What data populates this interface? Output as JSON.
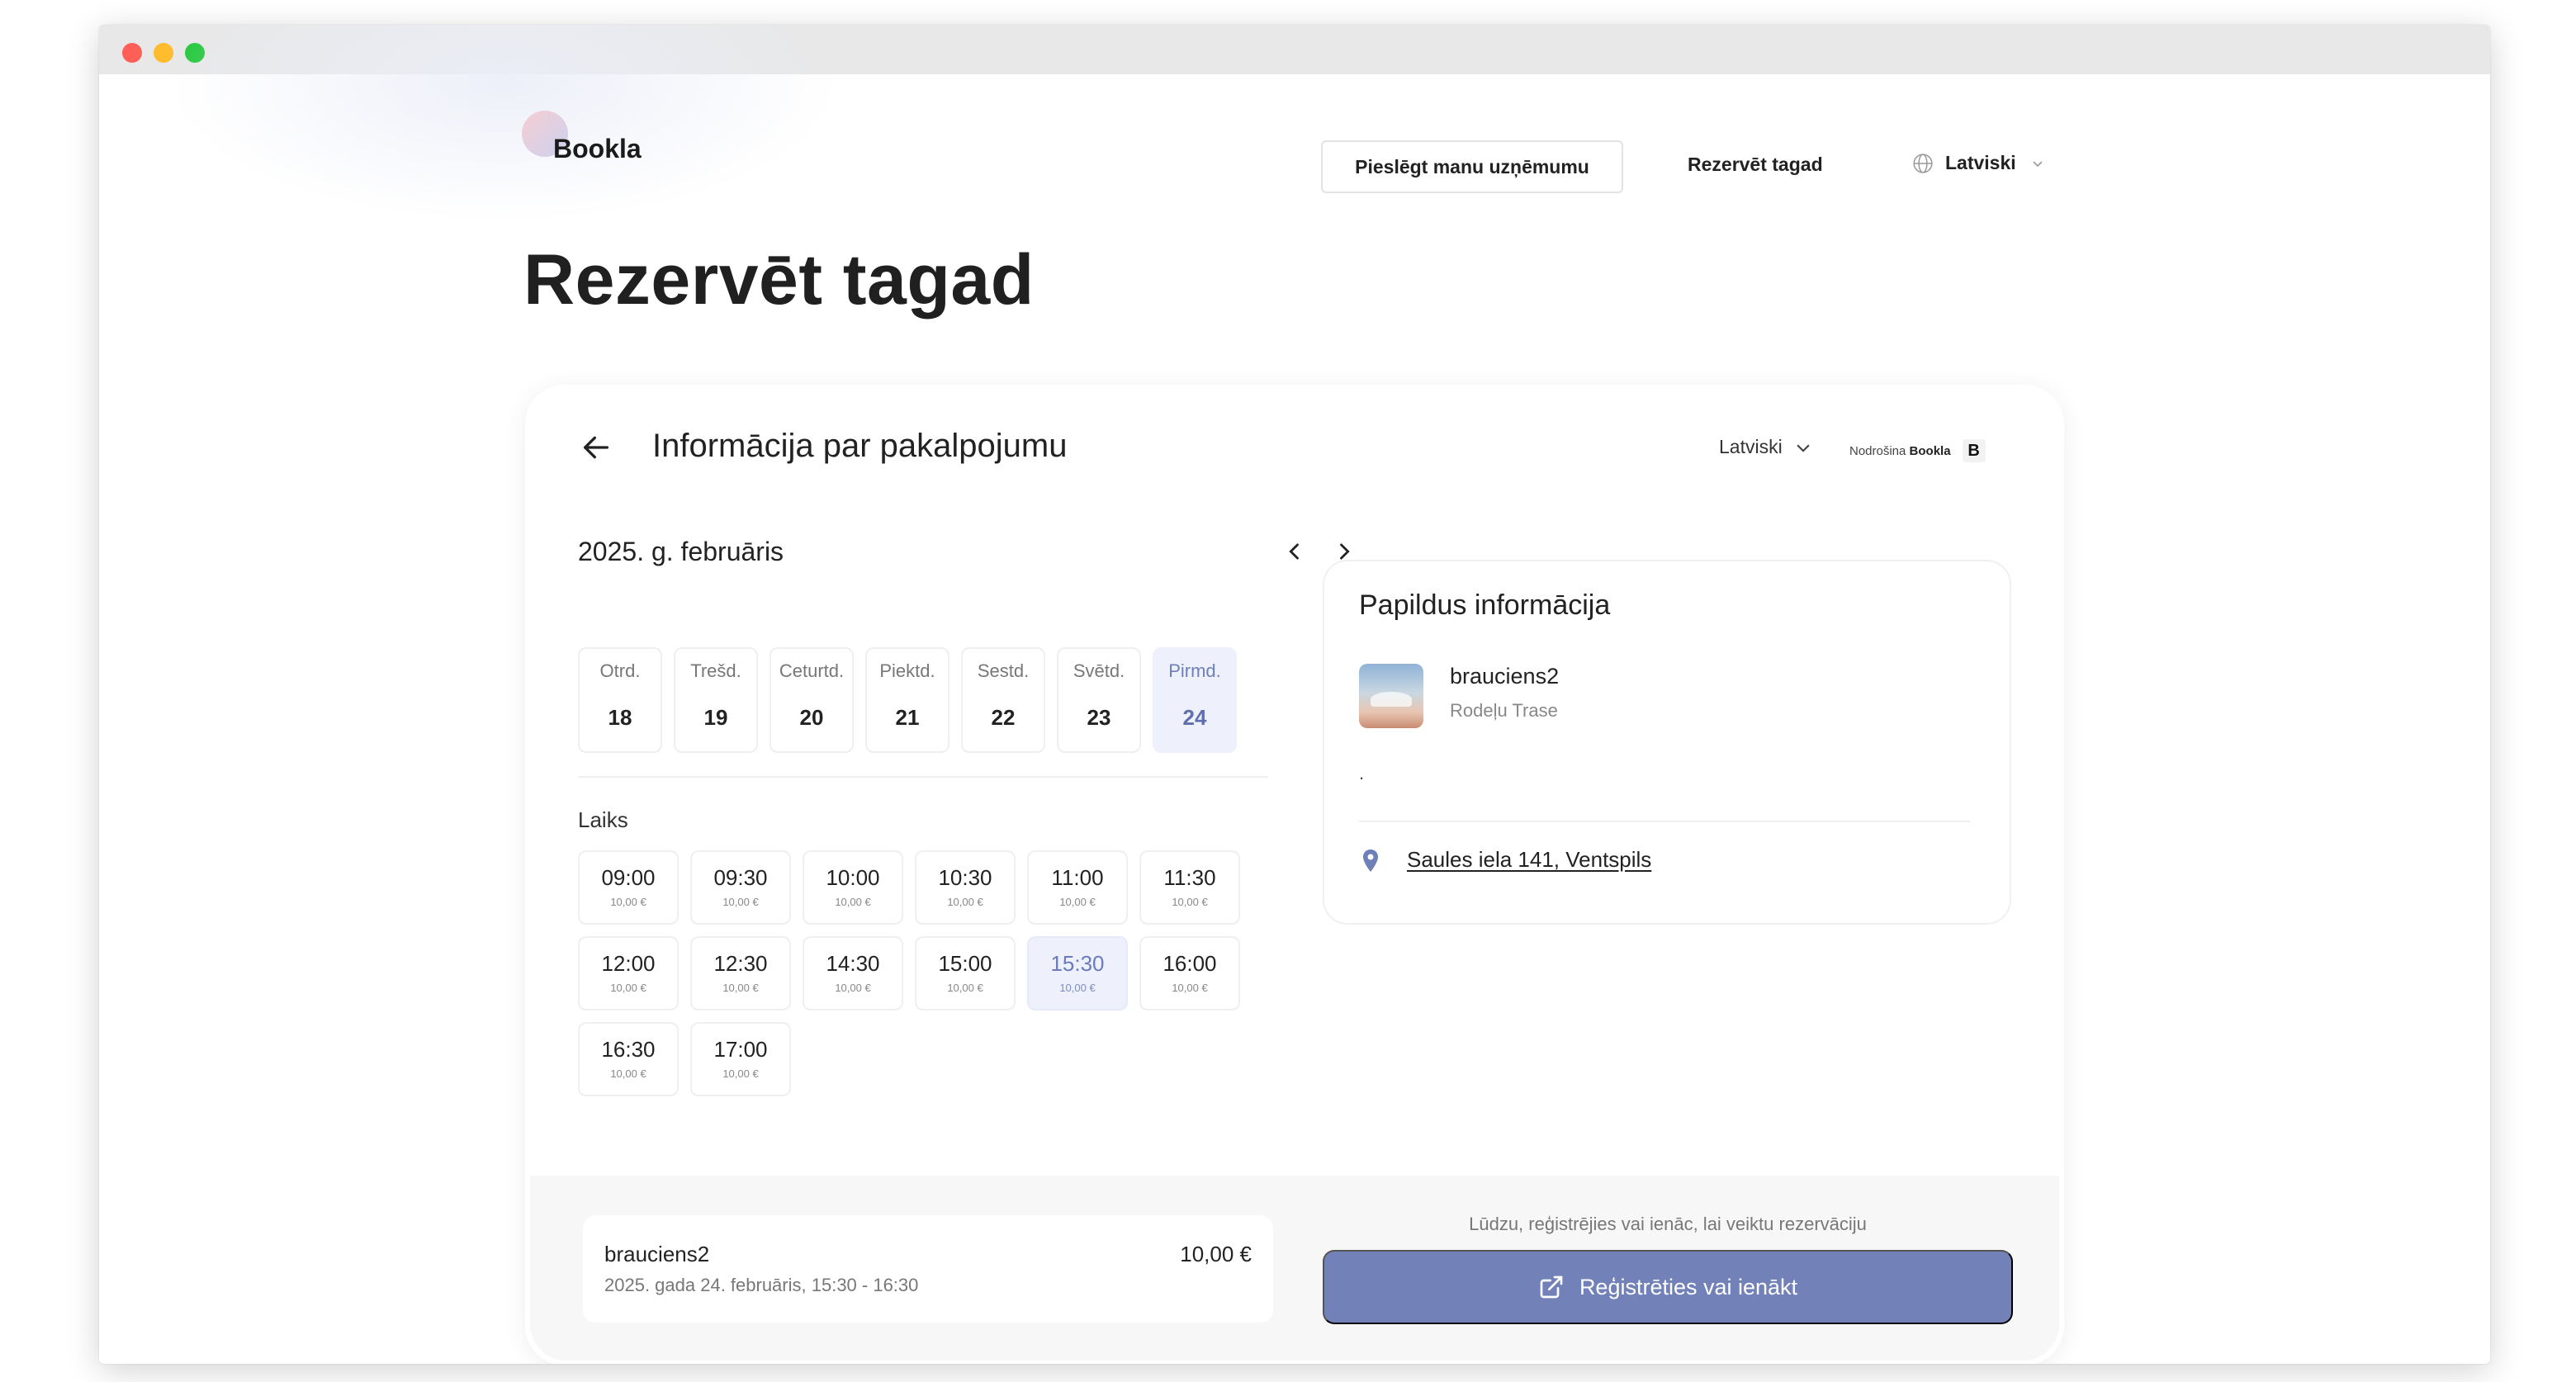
{
  "header": {
    "logo_text": "Bookla",
    "connect_button": "Pieslēgt manu uzņēmumu",
    "nav_reserve": "Rezervēt tagad",
    "language": "Latviski"
  },
  "page": {
    "title": "Rezervēt tagad"
  },
  "card": {
    "title": "Informācija par pakalpojumu",
    "language": "Latviski",
    "powered_by_prefix": "Nodrošina",
    "powered_by_brand": "Bookla",
    "badge": "B"
  },
  "calendar": {
    "month": "2025. g. februāris",
    "days": [
      {
        "name": "Otrd.",
        "date": "18"
      },
      {
        "name": "Trešd.",
        "date": "19"
      },
      {
        "name": "Ceturtd.",
        "date": "20"
      },
      {
        "name": "Piektd.",
        "date": "21"
      },
      {
        "name": "Sestd.",
        "date": "22"
      },
      {
        "name": "Svētd.",
        "date": "23"
      },
      {
        "name": "Pirmd.",
        "date": "24"
      }
    ],
    "selected_day_index": 6
  },
  "times": {
    "label": "Laiks",
    "slots": [
      {
        "time": "09:00",
        "price": "10,00 €"
      },
      {
        "time": "09:30",
        "price": "10,00 €"
      },
      {
        "time": "10:00",
        "price": "10,00 €"
      },
      {
        "time": "10:30",
        "price": "10,00 €"
      },
      {
        "time": "11:00",
        "price": "10,00 €"
      },
      {
        "time": "11:30",
        "price": "10,00 €"
      },
      {
        "time": "12:00",
        "price": "10,00 €"
      },
      {
        "time": "12:30",
        "price": "10,00 €"
      },
      {
        "time": "14:30",
        "price": "10,00 €"
      },
      {
        "time": "15:00",
        "price": "10,00 €"
      },
      {
        "time": "15:30",
        "price": "10,00 €"
      },
      {
        "time": "16:00",
        "price": "10,00 €"
      },
      {
        "time": "16:30",
        "price": "10,00 €"
      },
      {
        "time": "17:00",
        "price": "10,00 €"
      }
    ],
    "selected_slot_index": 10
  },
  "info": {
    "title": "Papildus informācija",
    "service_name": "brauciens2",
    "service_sub": "Rodeļu Trase",
    "description": ".",
    "address": "Saules iela 141, Ventspils"
  },
  "summary": {
    "name": "brauciens2",
    "date": "2025. gada 24. februāris, 15:30 - 16:30",
    "price": "10,00 €"
  },
  "cta": {
    "hint": "Lūdzu, reģistrējies vai ienāc, lai veiktu rezervāciju",
    "label": "Reģistrēties vai ienākt"
  },
  "colors": {
    "accent": "#7282b8",
    "selected_bg": "#eef1fb"
  }
}
